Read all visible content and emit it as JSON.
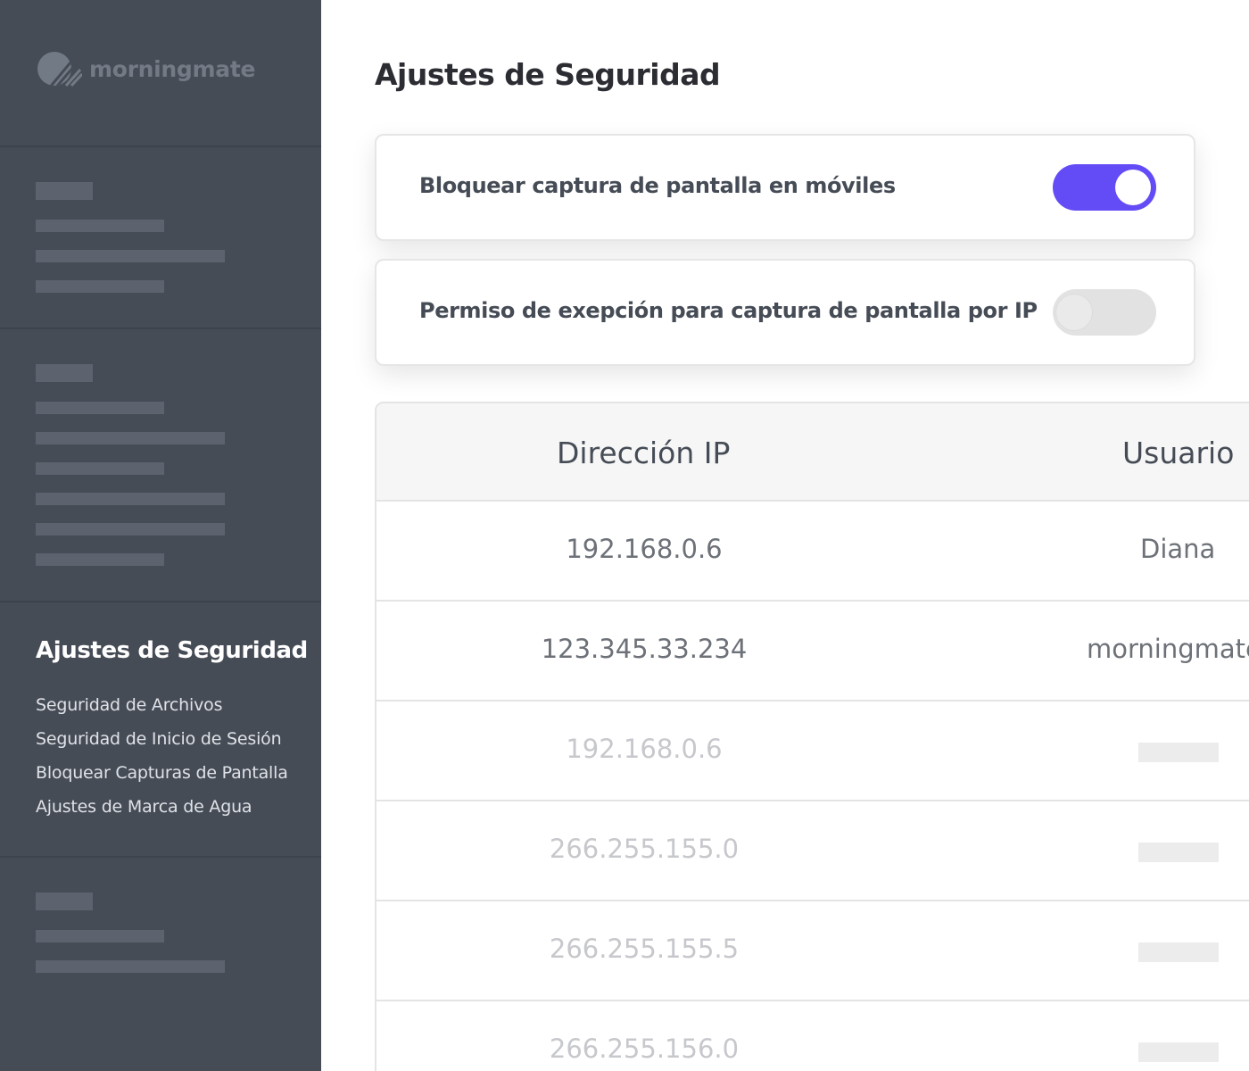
{
  "brand": {
    "name": "morningmate"
  },
  "sidebar": {
    "active_section": {
      "title": "Ajustes de Seguridad",
      "links": [
        "Seguridad de Archivos",
        "Seguridad de Inicio de Sesión",
        "Bloquear Capturas de Pantalla",
        "Ajustes de Marca de Agua"
      ]
    }
  },
  "main": {
    "title": "Ajustes de Seguridad",
    "settings": [
      {
        "label": "Bloquear captura de pantalla en móviles",
        "enabled": true
      },
      {
        "label": "Permiso de exepción para captura de pantalla por IP",
        "enabled": false
      }
    ],
    "table": {
      "headers": {
        "ip": "Dirección IP",
        "user": "Usuario"
      },
      "rows": [
        {
          "ip": "192.168.0.6",
          "user": "Diana"
        },
        {
          "ip": "123.345.33.234",
          "user": "morningmate"
        },
        {
          "ip": "192.168.0.6",
          "user": ""
        },
        {
          "ip": "266.255.155.0",
          "user": ""
        },
        {
          "ip": "266.255.155.5",
          "user": ""
        },
        {
          "ip": "266.255.156.0",
          "user": ""
        }
      ]
    }
  },
  "colors": {
    "sidebar_bg": "#464c56",
    "accent": "#634cf6",
    "toggle_off": "#e2e2e2",
    "text_dark": "#2b2d33"
  }
}
